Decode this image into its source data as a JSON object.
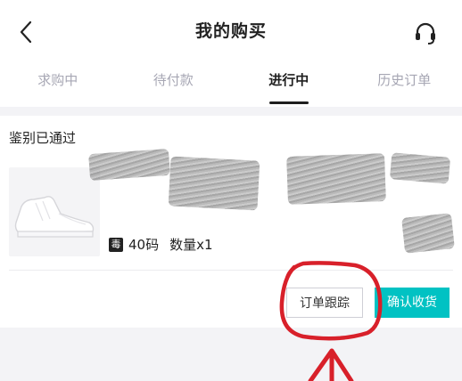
{
  "header": {
    "title": "我的购买",
    "back_icon": "chevron-left-icon",
    "support_icon": "headset-icon"
  },
  "tabs": [
    {
      "label": "求购中",
      "active": false
    },
    {
      "label": "待付款",
      "active": false
    },
    {
      "label": "进行中",
      "active": true
    },
    {
      "label": "历史订单",
      "active": false
    }
  ],
  "order": {
    "status": "鉴别已通过",
    "spec_badge": "毒",
    "size": "40码",
    "quantity": "数量x1",
    "buttons": {
      "track": "订单跟踪",
      "confirm": "确认收货"
    }
  },
  "colors": {
    "accent": "#01c2c3",
    "annotation": "#d8202a"
  }
}
